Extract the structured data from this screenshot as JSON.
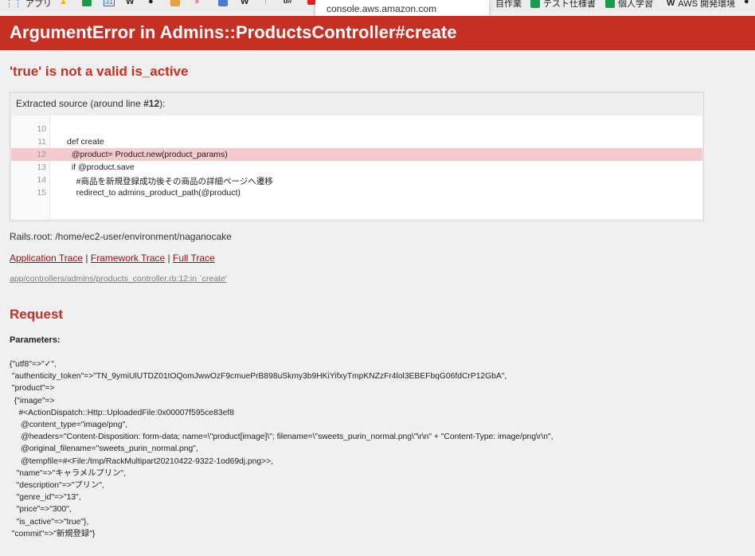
{
  "bookmarks": {
    "apps_label": "アプリ",
    "right_1": "自作業",
    "right_2": "テスト仕様書",
    "right_3": "個人学習",
    "right_4": "AWS 開発環境",
    "calendar_num": "31"
  },
  "tooltip": "console.aws.amazon.com",
  "header": {
    "title": "ArgumentError in Admins::ProductsController#create"
  },
  "error": {
    "message": "'true' is not a valid is_active"
  },
  "source": {
    "head_prefix": "Extracted source (around line ",
    "head_line": "#12",
    "head_suffix": "):",
    "lines": [
      {
        "num": "10",
        "code": ""
      },
      {
        "num": "11",
        "code": "def create"
      },
      {
        "num": "12",
        "code": "  @product= Product.new(product_params)"
      },
      {
        "num": "13",
        "code": "  if @product.save"
      },
      {
        "num": "14",
        "code": "    #商品を新規登録成功後その商品の詳細ページへ遷移"
      },
      {
        "num": "15",
        "code": "    redirect_to admins_product_path(@product)"
      }
    ]
  },
  "rails_root": "Rails.root: /home/ec2-user/environment/naganocake",
  "traces": {
    "application": "Application Trace",
    "framework": "Framework Trace",
    "full": "Full Trace",
    "sep": " | "
  },
  "frame": "app/controllers/admins/products_controller.rb:12:in `create'",
  "request": {
    "title": "Request",
    "params_label": "Parameters:",
    "params_text": "{\"utf8\"=>\"✓\",\n \"authenticity_token\"=>\"TN_9ymiUlUTDZ01tOQomJwwOzF9cmuePrB898uSkmy3b9HKiYifxyTmpKNZzFr4lol3EBEFbqG06fdCrP12GbA\",\n \"product\"=>\n  {\"image\"=>\n    #<ActionDispatch::Http::UploadedFile:0x00007f595ce83ef8\n     @content_type=\"image/png\",\n     @headers=\"Content-Disposition: form-data; name=\\\"product[image]\\\"; filename=\\\"sweets_purin_normal.png\\\"\\r\\n\" + \"Content-Type: image/png\\r\\n\",\n     @original_filename=\"sweets_purin_normal.png\",\n     @tempfile=#<File:/tmp/RackMultipart20210422-9322-1od69dj.png>>,\n   \"name\"=>\"キャラメルプリン\",\n   \"description\"=>\"プリン\",\n   \"genre_id\"=>\"13\",\n   \"price\"=>\"300\",\n   \"is_active\"=>\"true\"},\n \"commit\"=>\"新規登録\"}"
  }
}
